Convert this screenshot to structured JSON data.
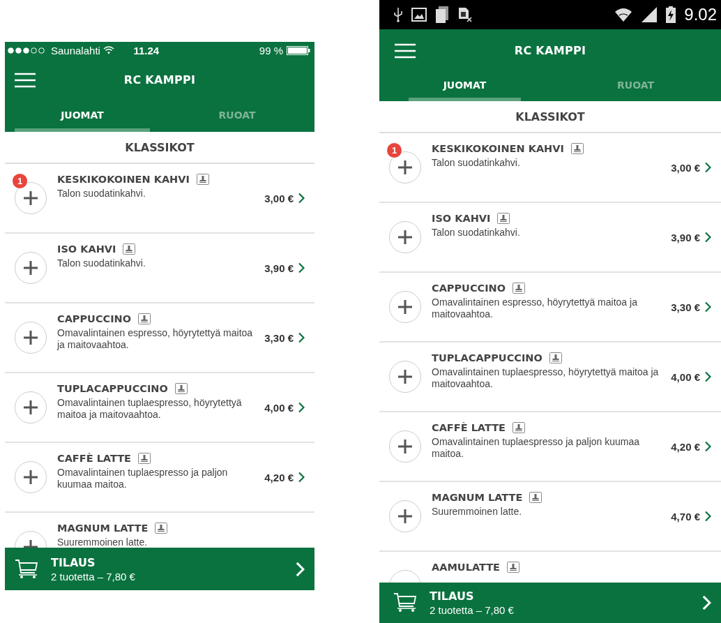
{
  "phones": [
    {
      "kind": "ios",
      "status_bar": {
        "carrier": "Saunalahti",
        "time": "11.24",
        "battery": "99 %"
      },
      "title": "RC KAMPPI",
      "tabs": [
        {
          "label": "JUOMAT",
          "selected": true
        },
        {
          "label": "RUOAT",
          "selected": false
        }
      ],
      "section": "KLASSIKOT",
      "items": [
        {
          "name": "KESKIKOKOINEN KAHVI",
          "description": "Talon suodatinkahvi.",
          "price": "3,00 €",
          "badge": "1"
        },
        {
          "name": "ISO KAHVI",
          "description": "Talon suodatinkahvi.",
          "price": "3,90 €"
        },
        {
          "name": "CAPPUCCINO",
          "description": "Omavalintainen espresso, höyrytettyä maitoa ja maitovaahtoa.",
          "price": "3,30 €"
        },
        {
          "name": "TUPLACAPPUCCINO",
          "description": "Omavalintainen tuplaespresso, höyrytettyä maitoa ja maitovaahtoa.",
          "price": "4,00 €"
        },
        {
          "name": "CAFFÈ LATTE",
          "description": "Omavalintainen tuplaespresso ja paljon kuumaa maitoa.",
          "price": "4,20 €"
        },
        {
          "name": "MAGNUM LATTE",
          "description": "Suuremmoinen latte."
        }
      ],
      "order": {
        "title": "TILAUS",
        "summary": "2 tuotetta – 7,80 €"
      }
    },
    {
      "kind": "android",
      "status_bar": {
        "time": "9.02"
      },
      "title": "RC KAMPPI",
      "tabs": [
        {
          "label": "JUOMAT",
          "selected": true
        },
        {
          "label": "RUOAT",
          "selected": false
        }
      ],
      "section": "KLASSIKOT",
      "items": [
        {
          "name": "KESKIKOKOINEN KAHVI",
          "description": "Talon suodatinkahvi.",
          "price": "3,00 €",
          "badge": "1"
        },
        {
          "name": "ISO KAHVI",
          "description": "Talon suodatinkahvi.",
          "price": "3,90 €"
        },
        {
          "name": "CAPPUCCINO",
          "description": "Omavalintainen espresso, höyrytettyä maitoa ja maitovaahtoa.",
          "price": "3,30 €"
        },
        {
          "name": "TUPLACAPPUCCINO",
          "description": "Omavalintainen tuplaespresso, höyrytettyä maitoa ja maitovaahtoa.",
          "price": "4,00 €"
        },
        {
          "name": "CAFFÈ LATTE",
          "description": "Omavalintainen tuplaespresso ja paljon kuumaa maitoa.",
          "price": "4,20 €"
        },
        {
          "name": "MAGNUM LATTE",
          "description": "Suuremmoinen latte.",
          "price": "4,70 €"
        },
        {
          "name": "AAMULATTE"
        }
      ],
      "order": {
        "title": "TILAUS",
        "summary": "2 tuotetta – 7,80 €"
      }
    }
  ]
}
